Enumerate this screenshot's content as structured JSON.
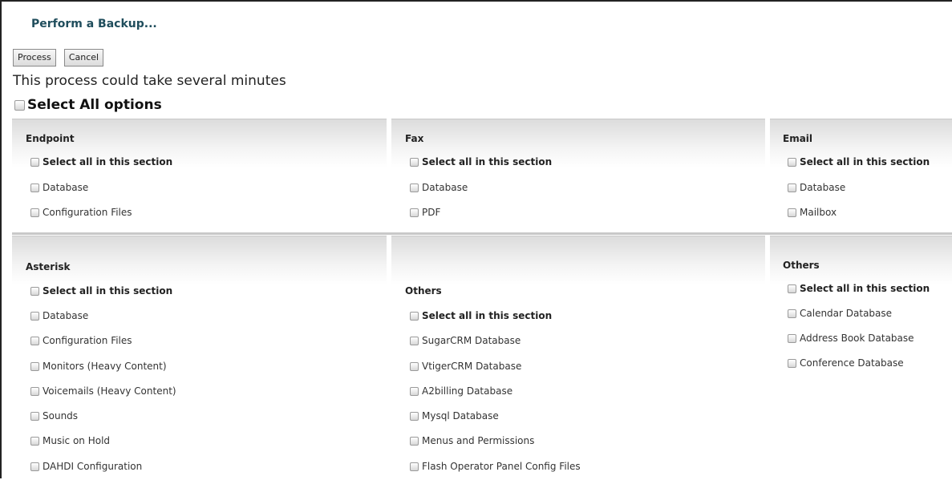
{
  "page": {
    "title": "Perform a Backup...",
    "process_label": "Process",
    "cancel_label": "Cancel",
    "hint": "This process could take several minutes",
    "select_all_label": "Select All options"
  },
  "sections": {
    "endpoint": {
      "title": "Endpoint",
      "select_all": "Select all in this section",
      "items": [
        "Database",
        "Configuration Files"
      ]
    },
    "fax": {
      "title": "Fax",
      "select_all": "Select all in this section",
      "items": [
        "Database",
        "PDF"
      ]
    },
    "email": {
      "title": "Email",
      "select_all": "Select all in this section",
      "items": [
        "Database",
        "Mailbox"
      ]
    },
    "asterisk": {
      "title": "Asterisk",
      "select_all": "Select all in this section",
      "items": [
        "Database",
        "Configuration Files",
        "Monitors (Heavy Content)",
        "Voicemails (Heavy Content)",
        "Sounds",
        "Music on Hold",
        "DAHDI Configuration"
      ]
    },
    "others_mid": {
      "title": "Others",
      "select_all": "Select all in this section",
      "items": [
        "SugarCRM Database",
        "VtigerCRM Database",
        "A2billing Database",
        "Mysql Database",
        "Menus and Permissions",
        "Flash Operator Panel Config Files"
      ]
    },
    "others_right": {
      "title": "Others",
      "select_all": "Select all in this section",
      "items": [
        "Calendar Database",
        "Address Book Database",
        "Conference Database"
      ]
    }
  }
}
